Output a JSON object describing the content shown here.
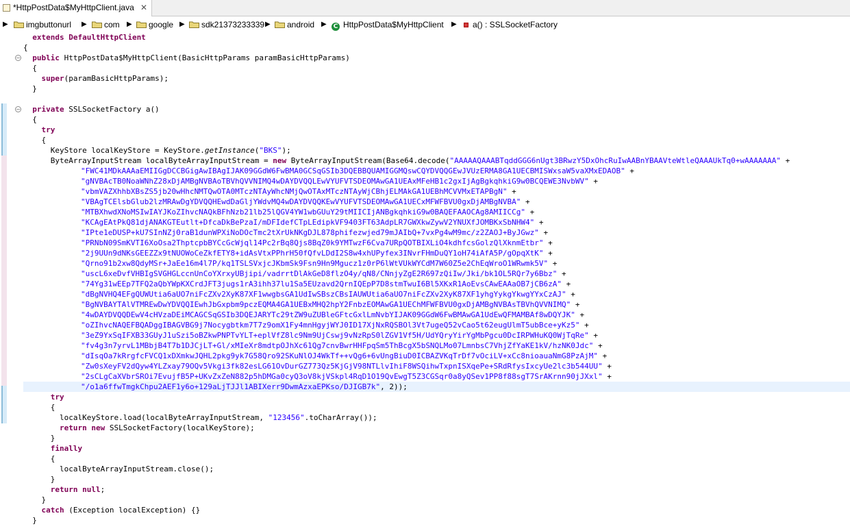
{
  "tab": {
    "title": "*HttpPostData$MyHttpClient.java",
    "close": "✕"
  },
  "breadcrumb": {
    "items": [
      {
        "label": "imgbuttonurl",
        "kind": "package"
      },
      {
        "label": "com",
        "kind": "package"
      },
      {
        "label": "google",
        "kind": "package"
      },
      {
        "label": "sdk21373233339",
        "kind": "package"
      },
      {
        "label": "android",
        "kind": "package"
      },
      {
        "label": "HttpPostData$MyHttpClient",
        "kind": "class"
      },
      {
        "label": "a() : SSLSocketFactory",
        "kind": "method"
      }
    ],
    "separator": "▶"
  },
  "code": {
    "l01": "  extends DefaultHttpClient",
    "l02": "{",
    "l03a": "  ",
    "l03kw": "public",
    "l03b": " HttpPostData$MyHttpClient(BasicHttpParams paramBasicHttpParams)",
    "l04": "  {",
    "l05a": "    ",
    "l05kw": "super",
    "l05b": "(paramBasicHttpParams);",
    "l06": "  }",
    "l07a": "  ",
    "l07kw": "private",
    "l07b": " SSLSocketFactory a()",
    "l08": "  {",
    "l09a": "    ",
    "l09kw": "try",
    "l10": "    {",
    "l11a": "      KeyStore localKeyStore = KeyStore.",
    "l11it": "getInstance",
    "l11b": "(",
    "l11s": "\"BKS\"",
    "l11c": ");",
    "l12a": "      ByteArrayInputStream localByteArrayInputStream = ",
    "l12kw": "new",
    "l12b": " ByteArrayInputStream(Base64.decode(",
    "l12s": "\"AAAAAQAAABTqddGGG6nUgt3BRwzY5DxOhcRuIwAABnYBAAVteWtleQAAAUkTq0+wAAAAAAA\"",
    "l12c": " +",
    "strings": [
      "\"FWC41MDkAAAaEMIIGgDCCBGigAwIBAgIJAK09GGdW6FwBMA0GCSqGSIb3DQEBBQUAMIGGMQswCQYDVQQGEwJVUzERMA8GA1UECBMISWxsaW5vaXMxEDAOB\"",
      "\"gNVBAcTB0NoaWNhZ28xDjAMBgNVBAoTBVhQVVNIMQ4wDAYDVQQLEwVYUFVTSDEOMAwGA1UEAxMFeHB1c2gxIjAgBgkqhkiG9w0BCQEWE3NvbWV\"",
      "\"vbmVAZXhhbXBsZS5jb20wHhcNMTQwOTA0MTczNTAyWhcNMjQwOTAxMTczNTAyWjCBhjELMAkGA1UEBhMCVVMxETAPBgN\"",
      "\"VBAgTCElsbGlub2lzMRAwDgYDVQQHEwdDaGljYWdvMQ4wDAYDVQQKEwVYUFVTSDEOMAwGA1UECxMFWFBVU0gxDjAMBgNVBA\"",
      "\"MTBXhwdXNoMSIwIAYJKoZIhvcNAQkBFhNzb21lb25lQGV4YW1wbGUuY29tMIICIjANBgkqhkiG9w0BAQEFAAOCAg8AMIICCg\"",
      "\"KCAgEAtPkQ81djANAKGTEutlt+DfcaDkBePzaI/mDFIdefCTpLEdipkVF9403FT63AdpLR7GWXkwZywV2YNUXfJOMBKxSbNHW4\"",
      "\"IPte1eDUSP+kU7SInNZj0raB1dunWPXiNoDOcTmc2tXrUkNKgDJL878phifezwjed79mJAIbQ+7vxPg4wM9mc/z2ZAOJ+ByJGwz\"",
      "\"PRNbN09SmKVTI6XoOsa2ThptcpbBYCcGcWjql14Pc2rBq8Qjs8BqZ0k9YMTwzF6Cva7URpQOTBIXLiO4kdhfcsGolzQlXknmEtbr\"",
      "\"2j9UUn9dNKsGEEZZx9tNUOWoCeZkfETY8+idAsVtxPPhrH50fQfvLDdI2S8w4xhUPyfex3INvrFHmDuQY1oH74iAfA5P/gOpqXtK\"",
      "\"Qrno91b2xw8QdyMSr+JaEe16m4l7P/kq1TSLSVxjcJKbmSk9Fsn9Hn9Mgucz1z0rP6lWtVUkWYCdM7W60Z5e2ChEqWroO1WRwmk5V\"",
      "\"uscL6xeDvfVHBIgSVGHGLccnUnCoYXrxyUBjipi/vadrrtDlAkGeD8flzO4y/qN8/CNnjyZgE2R697zQiIw/Jki/bk1OL5RQr7y6Bbz\"",
      "\"74Yg31wEEp7TFQ2aQbYWpKXCrdJFT3jugs1rA3ihh37lu1Sa5EUzavd2QrnIQEpP7D8stmTwuI6Bl5XKxR1AoEvsCAwEAAaOB7jCB6zA\"",
      "\"dBgNVHQ4EFgQUWUtia6aUO7niFcZXv2XyK87XF1wwgbsGA1UdIwSBszCBsIAUWUtia6aUO7niFcZXv2XyK87XF1yhgYykgYkwgYYxCzAJ\"",
      "\"BgNVBAYTAlVTMREwDwYDVQQIEwhJbGxpbm9pczEQMA4GA1UEBxMHQ2hpY2FnbzEOMAwGA1UEChMFWFBVU0gxDjAMBgNVBAsTBVhQVVNIMQ\"",
      "\"4wDAYDVQQDEwV4cHVzaDEiMCAGCSqGSIb3DQEJARYTc29tZW9uZUBleGFtcGxlLmNvbYIJAK09GGdW6FwBMAwGA1UdEwQFMAMBAf8wDQYJK\"",
      "\"oZIhvcNAQEFBQADggIBAGVBG9j7Nocygbtkm7T7z9omX1Fy4mnHgyjWYJ0ID17XjNxRQSBOl3Vt7ugeQ52vCao5t62eugUlmT5ubBce+yKz5\"",
      "\"3eZ9YxSqIFXB33GUyJ1uSzi5oBZkwPNPTvYLT+eplVfZ8lc9Nm9UjCswj9vNzRpS0lZGV1Vf5H/UdYQryYirYgMbPgcu0DcIRPWHuKQ0WjTqRe\"",
      "\"fv4g3n7yrvL1MBbjB4T7b1DJCjLT+Gl/xMIeXr8mdtpOJhXc61Qg7cnvBwrHHFpqSm5ThBcgX5bSNQLMo07LmnbsC7VhjZfYaKE1kV/hzNK0Jdc\"",
      "\"dIsqOa7kRrgfcFVCQ1xDXmkwJQHL2pkg9yk7G58Qro92SKuNlOJ4WkTf++vQg6+6vUngBiuD0ICBAZVKqTrDf7vOciLV+xCc8nioauaNmG8PzAjM\"",
      "\"Zw0sXeyFV2dQyw4YLZxay79OQv5Vkgi3fk82esLG61OvDurGZ773Qz5KjGjV98NTLlvIhiF8WSQihwTxpnISXqePe+SRdRfysIxcyUe2lc3b544UU\"",
      "\"2sCLgCaXVbrSROi7EvujfB5P+UKvZxZeN882p5hDMGa0cyQ3oV8kjVSkpl4RqD1O19QvEwgT5Z3CGSqr0a8yQSev1PP8f88sgT7SrAKrnn90jJXxl\"",
      "\"/o1a6ffwTmgkChpu2AEF1y6o+129aLjTJJl1ABIXerr9DwmAzxaEPKso/DJIGB7k\""
    ],
    "plus": " +",
    "lastSuffix": ", 2));",
    "l35a": "      ",
    "l35kw": "try",
    "l36": "      {",
    "l37a": "        localKeyStore.load(localByteArrayInputStream, ",
    "l37s": "\"123456\"",
    "l37b": ".toCharArray());",
    "l38a": "        ",
    "l38kw1": "return",
    "l38b": " ",
    "l38kw2": "new",
    "l38c": " SSLSocketFactory(localKeyStore);",
    "l39": "      }",
    "l40a": "      ",
    "l40kw": "finally",
    "l41": "      {",
    "l42": "        localByteArrayInputStream.close();",
    "l43": "      }",
    "l44a": "      ",
    "l44kw1": "return",
    "l44b": " ",
    "l44kw2": "null",
    "l44c": ";",
    "l45": "    }",
    "l46a": "    ",
    "l46kw": "catch",
    "l46b": " (Exception localException) {}",
    "l47": "  }"
  },
  "colors": {
    "keyword": "#7f0055",
    "string": "#2a00ff",
    "currentLine": "#e8f2fe"
  }
}
